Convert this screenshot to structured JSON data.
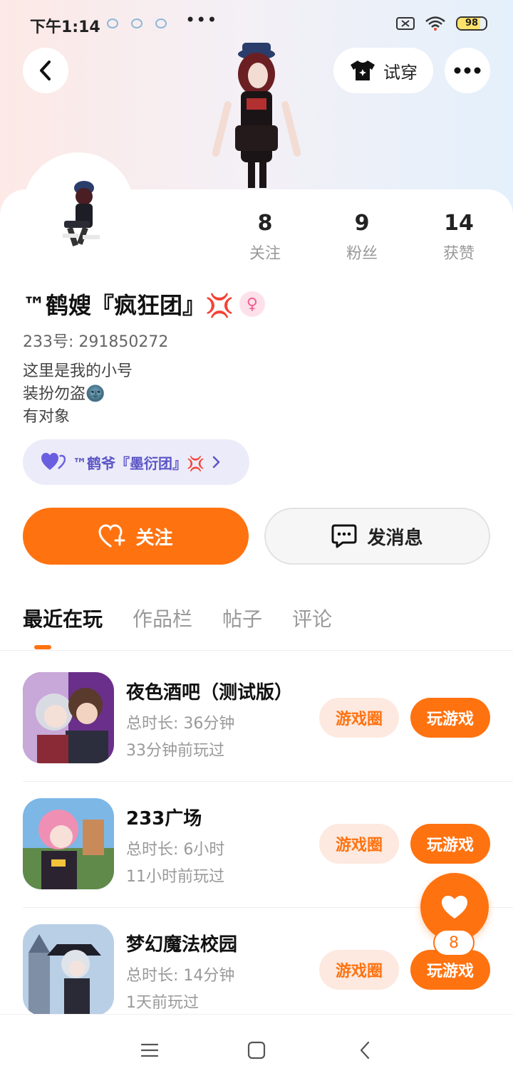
{
  "status_bar": {
    "time": "下午1:14",
    "dots": "•••",
    "battery": "98"
  },
  "header": {
    "try_on_label": "试穿"
  },
  "stats": [
    {
      "value": "8",
      "label": "关注"
    },
    {
      "value": "9",
      "label": "粉丝"
    },
    {
      "value": "14",
      "label": "获赞"
    }
  ],
  "profile": {
    "name": "™鹤嫂『疯狂团』💢",
    "gender": "female",
    "uid": "233号: 291850272",
    "bio": [
      "这里是我的小号",
      "装扮勿盗🌚",
      "有对象"
    ]
  },
  "cp": {
    "name": "™鹤爷『墨衍团』💢"
  },
  "actions": {
    "follow_label": "关注",
    "message_label": "发消息"
  },
  "tabs": [
    "最近在玩",
    "作品栏",
    "帖子",
    "评论"
  ],
  "games": [
    {
      "title": "夜色酒吧（测试版）",
      "duration": "总时长: 36分钟",
      "last_played": "33分钟前玩过",
      "circle_label": "游戏圈",
      "play_label": "玩游戏"
    },
    {
      "title": "233广场",
      "duration": "总时长: 6小时",
      "last_played": "11小时前玩过",
      "circle_label": "游戏圈",
      "play_label": "玩游戏"
    },
    {
      "title": "梦幻魔法校园",
      "duration": "总时长: 14分钟",
      "last_played": "1天前玩过",
      "circle_label": "游戏圈",
      "play_label": "玩游戏"
    }
  ],
  "fab": {
    "count": "8"
  },
  "colors": {
    "accent": "#ff7210",
    "accent_light": "#fde9df",
    "cp_bg": "#ecebf9",
    "cp_text": "#5b55c6"
  }
}
